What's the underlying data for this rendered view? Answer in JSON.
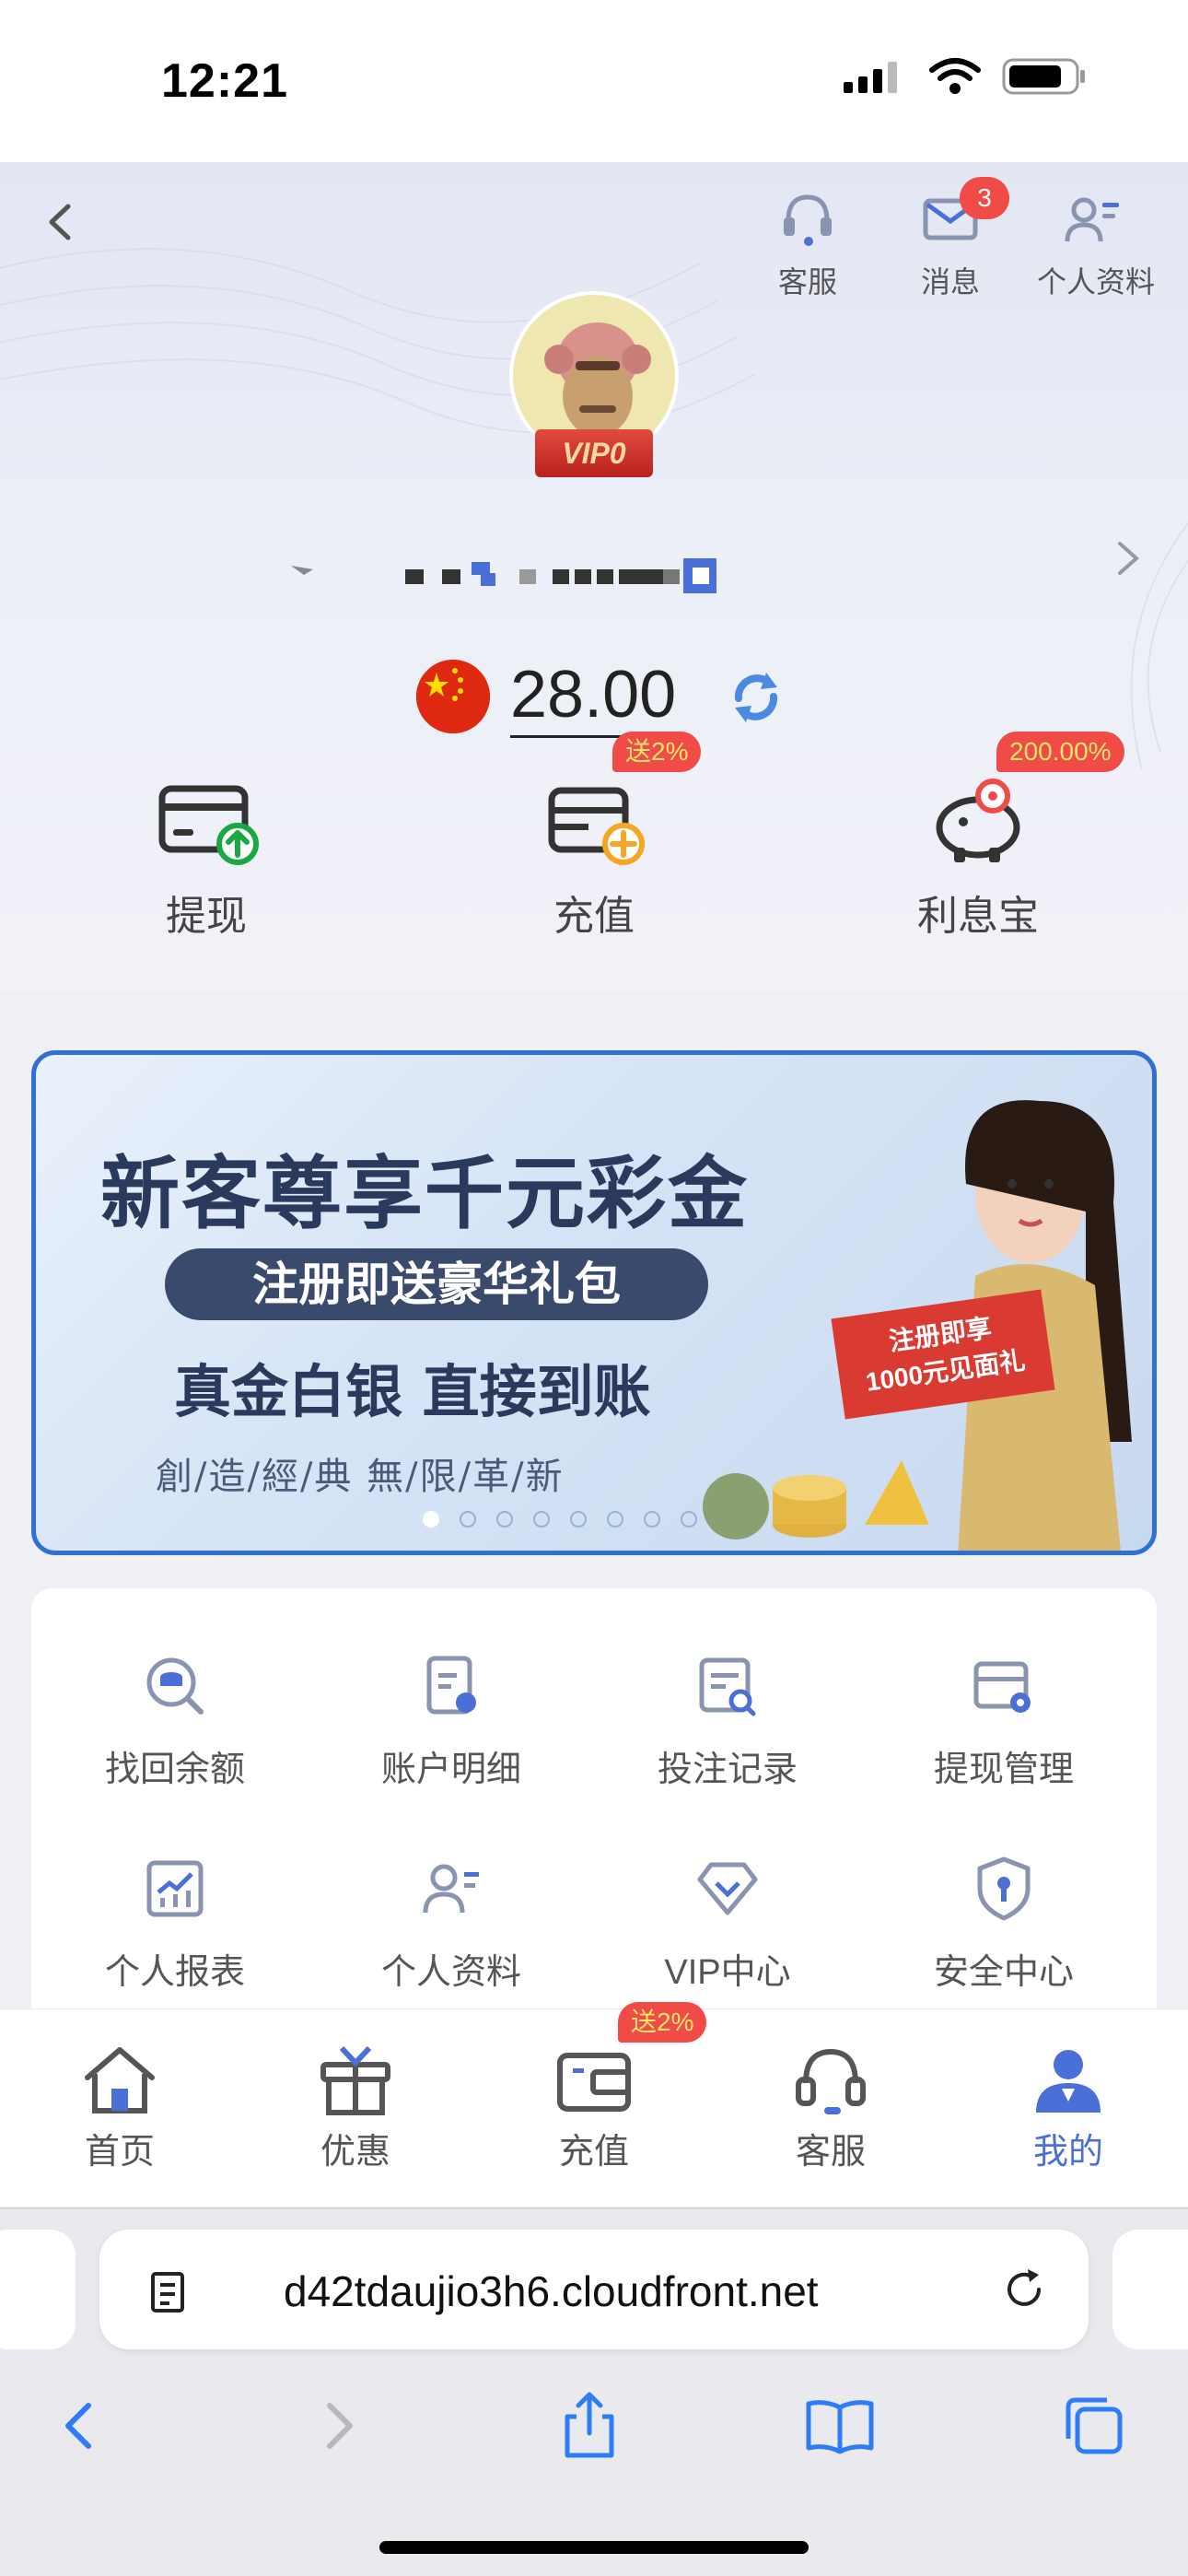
{
  "status_bar": {
    "time": "12:21"
  },
  "header": {
    "actions": [
      {
        "label": "客服",
        "icon": "headset-icon"
      },
      {
        "label": "消息",
        "icon": "mail-icon",
        "badge": "3"
      },
      {
        "label": "个人资料",
        "icon": "profile-card-icon"
      }
    ],
    "vip_level": "VIP0",
    "balance": "28.00"
  },
  "quick_actions": [
    {
      "label": "提现",
      "icon": "withdraw-card-icon"
    },
    {
      "label": "充值",
      "icon": "deposit-icon",
      "promo": "送2%"
    },
    {
      "label": "利息宝",
      "icon": "piggy-bank-icon",
      "promo": "200.00%"
    }
  ],
  "banner": {
    "title": "新客尊享千元彩金",
    "pill": "注册即送豪华礼包",
    "subtitle": "真金白银 直接到账",
    "footer": "創/造/經/典 無/限/革/新",
    "ribbon_line1": "注册即享",
    "ribbon_line2": "1000元见面礼",
    "dot_count": 8,
    "active_dot": 0
  },
  "menu": [
    {
      "label": "找回余额",
      "icon": "retrieve-balance-icon"
    },
    {
      "label": "账户明细",
      "icon": "account-details-icon"
    },
    {
      "label": "投注记录",
      "icon": "bet-records-icon"
    },
    {
      "label": "提现管理",
      "icon": "withdraw-manage-icon"
    },
    {
      "label": "个人报表",
      "icon": "report-icon"
    },
    {
      "label": "个人资料",
      "icon": "personal-info-icon"
    },
    {
      "label": "VIP中心",
      "icon": "vip-icon"
    },
    {
      "label": "安全中心",
      "icon": "shield-icon"
    }
  ],
  "tabbar": [
    {
      "label": "首页",
      "icon": "home-icon"
    },
    {
      "label": "优惠",
      "icon": "gift-icon"
    },
    {
      "label": "充值",
      "icon": "wallet-icon",
      "promo": "送2%"
    },
    {
      "label": "客服",
      "icon": "headset-icon"
    },
    {
      "label": "我的",
      "icon": "user-icon",
      "active": true
    }
  ],
  "browser": {
    "url": "d42tdaujio3h6.cloudfront.net"
  },
  "colors": {
    "accent": "#4a70d8",
    "promo_red": "#f04b46",
    "banner_border": "#2f6fd6",
    "green": "#1aa845",
    "orange": "#f5a623"
  }
}
